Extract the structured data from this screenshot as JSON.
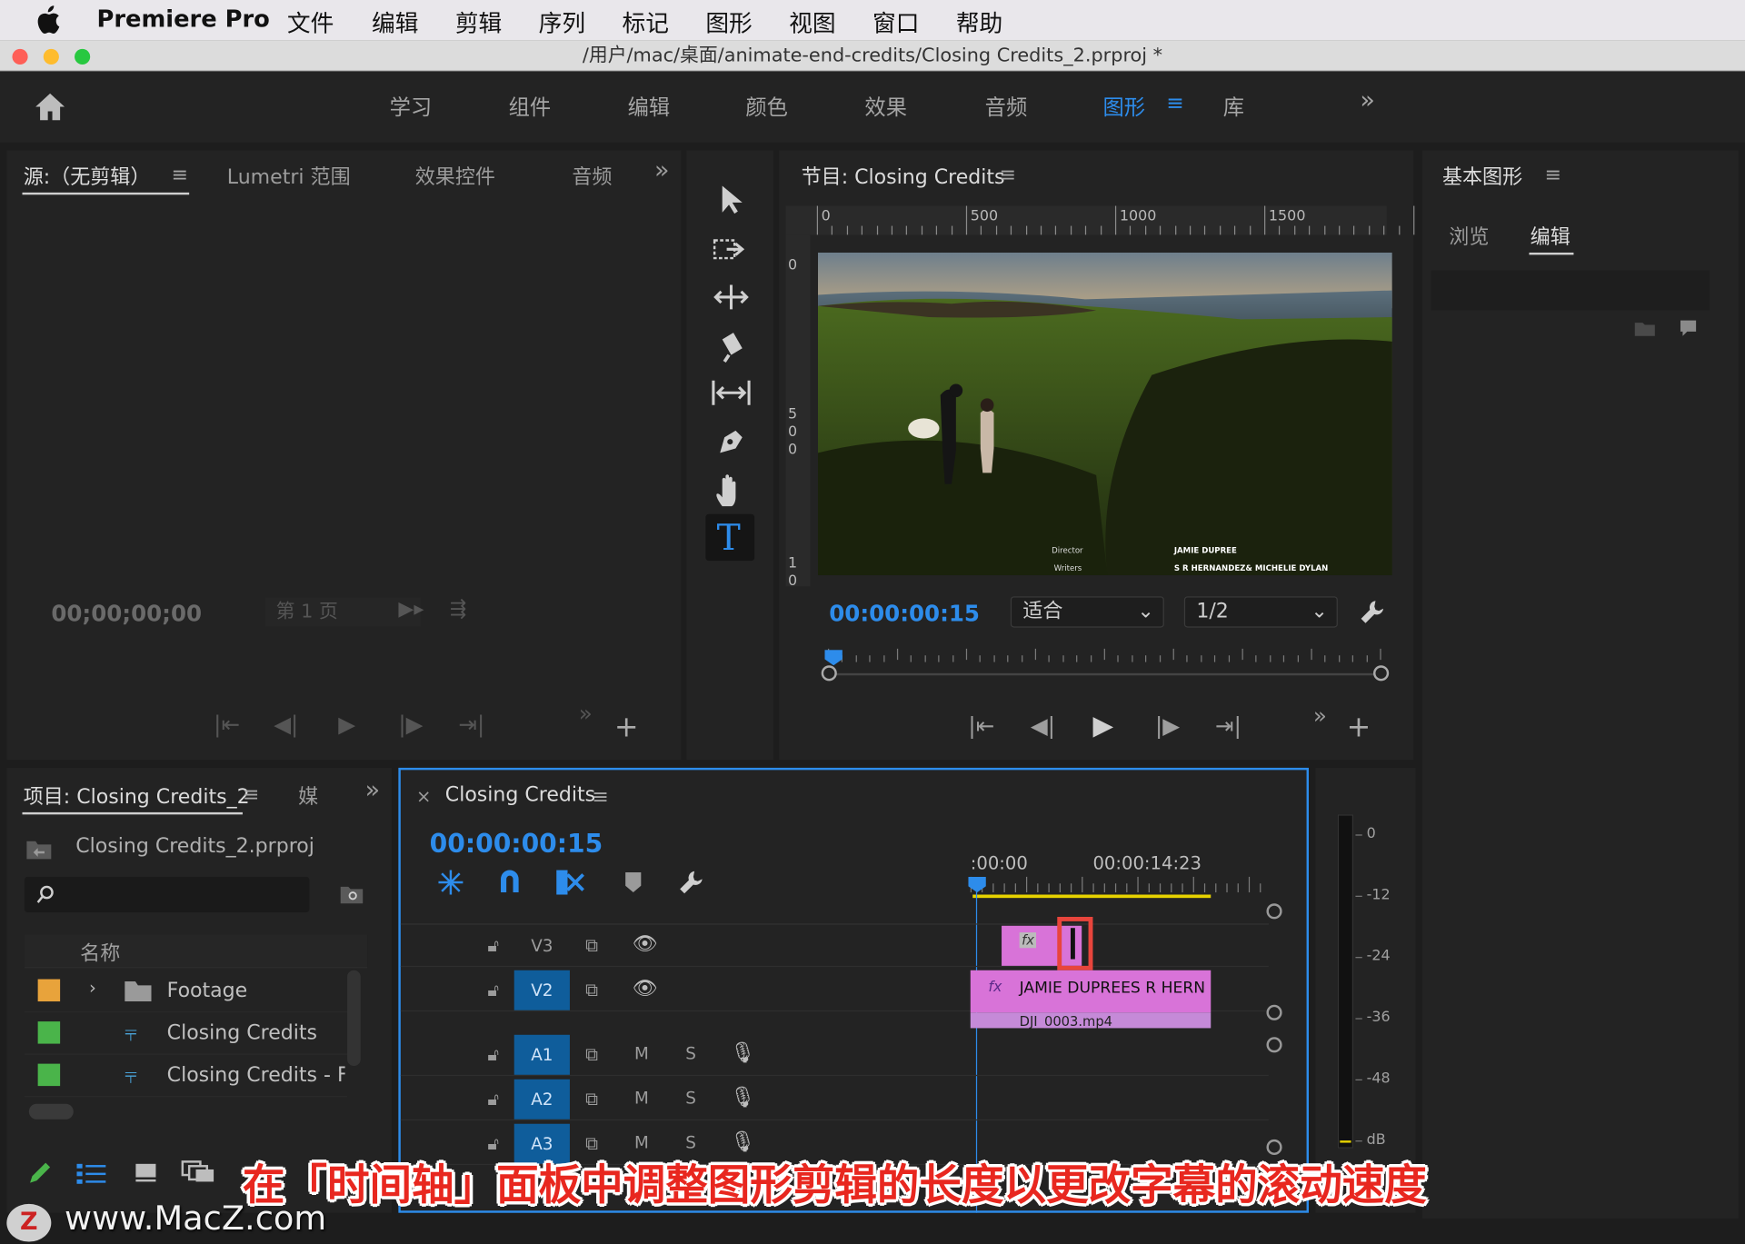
{
  "menubar": {
    "app": "Premiere Pro",
    "items": [
      "文件",
      "编辑",
      "剪辑",
      "序列",
      "标记",
      "图形",
      "视图",
      "窗口",
      "帮助"
    ]
  },
  "window": {
    "title": "/用户/mac/桌面/animate-end-credits/Closing Credits_2.prproj *"
  },
  "workspaces": [
    "学习",
    "组件",
    "编辑",
    "颜色",
    "效果",
    "音频",
    "图形",
    "库"
  ],
  "active_workspace": "图形",
  "source_panel": {
    "tabs": [
      "源:（无剪辑）",
      "Lumetri 范围",
      "效果控件",
      "音频"
    ],
    "timecode": "00;00;00;00",
    "page": "第 1 页"
  },
  "program_panel": {
    "title": "节目: Closing Credits",
    "ruler": [
      "0",
      "500",
      "1000",
      "1500"
    ],
    "vruler": [
      "0",
      "5",
      "0",
      "0",
      "1",
      "0"
    ],
    "timecode": "00:00:00:15",
    "fit": "适合",
    "resolution": "1/2",
    "overlay": {
      "left1": "Director",
      "left2": "Writers",
      "right1": "JAMIE DUPREE",
      "right2": "S R HERNANDEZ& MICHELIE DYLAN"
    }
  },
  "essential_graphics": {
    "title": "基本图形",
    "tabs": [
      "浏览",
      "编辑"
    ]
  },
  "project_panel": {
    "title": "项目: Closing Credits_2",
    "media_tab": "媒",
    "file": "Closing Credits_2.prproj",
    "column": "名称",
    "items": [
      {
        "name": "Footage",
        "color": "#e8a33b"
      },
      {
        "name": "Closing Credits",
        "color": "#4ab44a"
      },
      {
        "name": "Closing Credits - Fina",
        "color": "#4ab44a"
      }
    ]
  },
  "timeline": {
    "title": "Closing Credits",
    "timecode": "00:00:00:15",
    "ruler": [
      ":00:00",
      "00:00:14:23"
    ],
    "tracks": [
      "V3",
      "V2",
      "A1",
      "A2",
      "A3"
    ],
    "m": "M",
    "s": "S",
    "clip_v2": "JAMIE DUPREES R HERN",
    "clip_v1": "DJI_0003.mp4"
  },
  "meter": {
    "scale": [
      "0",
      "-12",
      "-24",
      "-36",
      "-48",
      "dB"
    ]
  },
  "subtitle": "在「时间轴」面板中调整图形剪辑的长度以更改字幕的滚动速度",
  "watermark": "www.MacZ.com",
  "colors": {
    "accent": "#2d8ceb",
    "clip": "#d873d8",
    "highlight": "#e8453c",
    "caption": "#e8271f"
  }
}
